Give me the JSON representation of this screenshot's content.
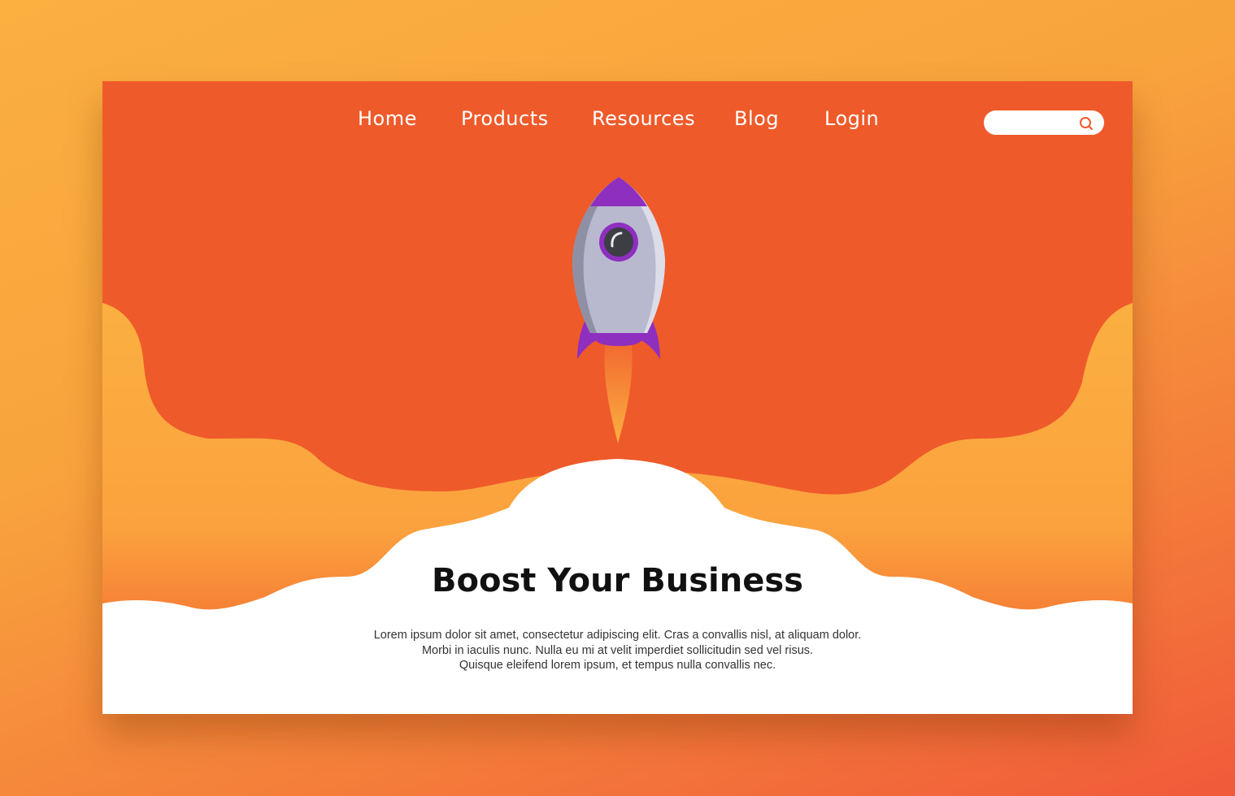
{
  "nav": {
    "items": [
      {
        "label": "Home"
      },
      {
        "label": "Products"
      },
      {
        "label": "Resources"
      },
      {
        "label": "Blog"
      },
      {
        "label": "Login"
      }
    ]
  },
  "search": {
    "placeholder": "",
    "icon": "search-icon"
  },
  "hero": {
    "title": "Boost Your Business",
    "lines": [
      "Lorem ipsum dolor sit amet, consectetur adipiscing elit. Cras a convallis nisl, at aliquam dolor.",
      "Morbi in iaculis nunc. Nulla eu mi at velit imperdiet sollicitudin sed vel risus.",
      "Quisque eleifend lorem ipsum, et tempus nulla convallis nec."
    ]
  },
  "colors": {
    "primary": "#ef5a2a",
    "secondary": "#fbb040",
    "rocket_accent": "#8a2be2",
    "rocket_body": "#b8b9cf"
  }
}
